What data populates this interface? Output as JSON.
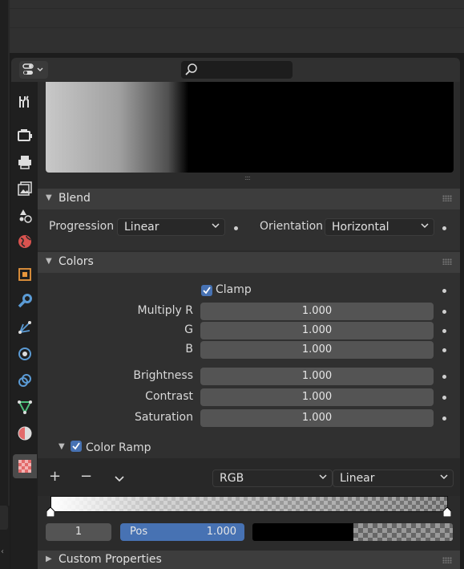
{
  "search": {
    "placeholder": ""
  },
  "tabs": [
    "tool-icon",
    "render-icon",
    "output-icon",
    "view-layer-icon",
    "scene-icon",
    "world-icon",
    "object-icon",
    "modifier-icon",
    "particles-icon",
    "physics-icon",
    "constraints-icon",
    "data-icon",
    "material-icon",
    "texture-icon"
  ],
  "blend": {
    "title": "Blend",
    "progression_label": "Progression",
    "progression_value": "Linear",
    "orientation_label": "Orientation",
    "orientation_value": "Horizontal"
  },
  "colors": {
    "title": "Colors",
    "clamp_label": "Clamp",
    "clamp_checked": true,
    "multiply_r_label": "Multiply R",
    "multiply_r": "1.000",
    "g_label": "G",
    "g": "1.000",
    "b_label": "B",
    "b": "1.000",
    "brightness_label": "Brightness",
    "brightness": "1.000",
    "contrast_label": "Contrast",
    "contrast": "1.000",
    "saturation_label": "Saturation",
    "saturation": "1.000"
  },
  "color_ramp": {
    "label": "Color Ramp",
    "enabled": true,
    "add": "+",
    "remove": "−",
    "menu": "⌄",
    "color_mode": "RGB",
    "interpolation": "Linear",
    "index": "1",
    "pos_label": "Pos",
    "pos_value": "1.000"
  },
  "custom_properties": {
    "title": "Custom Properties"
  },
  "accent": "#4772b3"
}
